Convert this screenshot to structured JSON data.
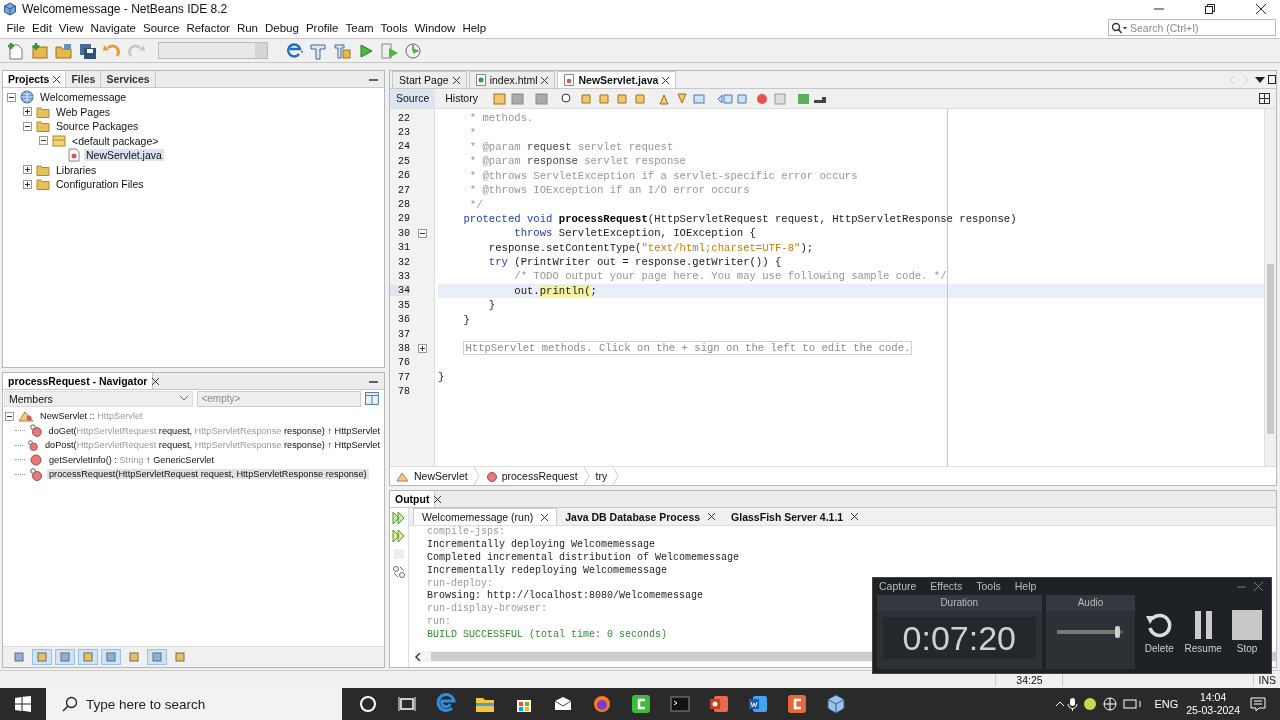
{
  "window": {
    "title": "Welcomemessage - NetBeans IDE 8.2"
  },
  "menu": [
    "File",
    "Edit",
    "View",
    "Navigate",
    "Source",
    "Refactor",
    "Run",
    "Debug",
    "Profile",
    "Team",
    "Tools",
    "Window",
    "Help"
  ],
  "search": {
    "placeholder": "Search (Ctrl+I)"
  },
  "toolbar": [
    {
      "kind": "new-file",
      "disabled": false
    },
    {
      "kind": "new-project",
      "disabled": false
    },
    {
      "kind": "open-project",
      "disabled": false
    },
    {
      "kind": "save-all",
      "disabled": false
    },
    {
      "kind": "undo",
      "disabled": false
    },
    {
      "kind": "redo",
      "disabled": true
    },
    {
      "kind": "config",
      "disabled": false
    },
    {
      "kind": "browser",
      "disabled": false
    },
    {
      "kind": "build",
      "disabled": false
    },
    {
      "kind": "clean-build",
      "disabled": false
    },
    {
      "kind": "run",
      "disabled": false
    },
    {
      "kind": "debug",
      "disabled": false
    },
    {
      "kind": "profile",
      "disabled": false
    }
  ],
  "projects_panel": {
    "tabs": [
      {
        "label": "Projects",
        "selected": true
      },
      {
        "label": "Files",
        "selected": false
      },
      {
        "label": "Services",
        "selected": false
      }
    ],
    "tree": [
      {
        "label": "Welcomemessage",
        "kind": "project",
        "expanded": true,
        "selected": false,
        "children": [
          {
            "label": "Web Pages",
            "kind": "folder",
            "expanded": false,
            "selected": false
          },
          {
            "label": "Source Packages",
            "kind": "folder",
            "expanded": true,
            "selected": false,
            "children": [
              {
                "label": "<default package>",
                "kind": "package",
                "expanded": true,
                "selected": false,
                "children": [
                  {
                    "label": "NewServlet.java",
                    "kind": "file",
                    "selected": true
                  }
                ]
              }
            ]
          },
          {
            "label": "Libraries",
            "kind": "folder",
            "expanded": false,
            "selected": false
          },
          {
            "label": "Configuration Files",
            "kind": "folder",
            "expanded": false,
            "selected": false
          }
        ]
      }
    ]
  },
  "navigator": {
    "title": "processRequest - Navigator",
    "filter": "Members",
    "search_placeholder": "<empty>",
    "tree": [
      {
        "kind": "class",
        "expanded": true,
        "selected": false,
        "parts": [
          {
            "text": "NewServlet :: ",
            "muted": false
          },
          {
            "text": "HttpServlet",
            "muted": true
          }
        ],
        "children": [
          {
            "kind": "method",
            "selected": false,
            "parts": [
              {
                "text": "doGet(",
                "muted": false
              },
              {
                "text": "HttpServletRequest",
                "muted": true
              },
              {
                "text": " request, ",
                "muted": false
              },
              {
                "text": "HttpServletResponse",
                "muted": true
              },
              {
                "text": " response) ↑ HttpServlet",
                "muted": false
              }
            ]
          },
          {
            "kind": "method",
            "selected": false,
            "parts": [
              {
                "text": "doPost(",
                "muted": false
              },
              {
                "text": "HttpServletRequest",
                "muted": true
              },
              {
                "text": " request, ",
                "muted": false
              },
              {
                "text": "HttpServletResponse",
                "muted": true
              },
              {
                "text": " response) ↑ HttpServlet",
                "muted": false
              }
            ]
          },
          {
            "kind": "public-method",
            "selected": false,
            "parts": [
              {
                "text": "getServletInfo() : ",
                "muted": false
              },
              {
                "text": "String",
                "muted": true
              },
              {
                "text": " ↑ GenericServlet",
                "muted": false
              }
            ]
          },
          {
            "kind": "method",
            "selected": true,
            "parts": [
              {
                "text": "processRequest(HttpServletRequest request, HttpServletResponse response)",
                "muted": false
              }
            ]
          }
        ]
      }
    ],
    "tools": [
      {
        "pressed": false
      },
      {
        "pressed": true
      },
      {
        "pressed": true
      },
      {
        "pressed": true
      },
      {
        "pressed": true
      },
      {
        "pressed": false
      },
      {
        "pressed": true
      },
      {
        "pressed": false
      }
    ]
  },
  "editor": {
    "tabs": [
      {
        "label": "Start Page",
        "kind": "page",
        "selected": false
      },
      {
        "label": "index.html",
        "kind": "html",
        "selected": false
      },
      {
        "label": "NewServlet.java",
        "kind": "java",
        "selected": true
      }
    ],
    "views": [
      {
        "label": "Source",
        "selected": true
      },
      {
        "label": "History",
        "selected": false
      }
    ],
    "lines": [
      {
        "number": "22",
        "current": false,
        "segments": [
          {
            "kind": "comment",
            "text": "     * methods."
          }
        ]
      },
      {
        "number": "23",
        "current": false,
        "segments": [
          {
            "kind": "comment",
            "text": "     *"
          }
        ]
      },
      {
        "number": "24",
        "current": false,
        "segments": [
          {
            "kind": "comment",
            "text": "     * "
          },
          {
            "kind": "tag",
            "text": "@param"
          },
          {
            "kind": "name",
            "text": " request"
          },
          {
            "kind": "comment",
            "text": " servlet request"
          }
        ]
      },
      {
        "number": "25",
        "current": false,
        "segments": [
          {
            "kind": "comment",
            "text": "     * "
          },
          {
            "kind": "tag",
            "text": "@param"
          },
          {
            "kind": "name",
            "text": " response"
          },
          {
            "kind": "comment",
            "text": " servlet response"
          }
        ]
      },
      {
        "number": "26",
        "current": false,
        "segments": [
          {
            "kind": "comment",
            "text": "     * @throws ServletException if a servlet-specific error occurs"
          }
        ]
      },
      {
        "number": "27",
        "current": false,
        "segments": [
          {
            "kind": "comment",
            "text": "     * @throws IOException if an I/O error occurs"
          }
        ]
      },
      {
        "number": "28",
        "current": false,
        "segments": [
          {
            "kind": "comment",
            "text": "     */"
          }
        ]
      },
      {
        "number": "29",
        "current": false,
        "segments": [
          {
            "kind": "keyword",
            "text": "    protected void "
          },
          {
            "kind": "method",
            "text": "processRequest"
          },
          {
            "kind": "plain",
            "text": "(HttpServletRequest request, HttpServletResponse response)"
          }
        ]
      },
      {
        "number": "30",
        "expanded": true,
        "current": false,
        "segments": [
          {
            "kind": "keyword",
            "text": "            throws "
          },
          {
            "kind": "plain",
            "text": "ServletException, IOException {"
          }
        ]
      },
      {
        "number": "31",
        "current": false,
        "segments": [
          {
            "kind": "plain",
            "text": "        response.setContentType("
          },
          {
            "kind": "string",
            "text": "\"text/html;charset=UTF-8\""
          },
          {
            "kind": "plain",
            "text": ");"
          }
        ]
      },
      {
        "number": "32",
        "current": false,
        "segments": [
          {
            "kind": "keyword",
            "text": "        try "
          },
          {
            "kind": "plain",
            "text": "(PrintWriter out = response.getWriter()) {"
          }
        ]
      },
      {
        "number": "33",
        "current": false,
        "segments": [
          {
            "kind": "comment",
            "text": "            /* TODO output your page here. You may use following sample code. */"
          }
        ]
      },
      {
        "number": "34",
        "current": true,
        "segments": [
          {
            "kind": "plain",
            "text": "            out."
          },
          {
            "kind": "highlight",
            "text": "println("
          },
          {
            "kind": "plain",
            "text": ";"
          }
        ]
      },
      {
        "number": "35",
        "current": false,
        "segments": [
          {
            "kind": "plain",
            "text": "        }"
          }
        ]
      },
      {
        "number": "36",
        "current": false,
        "segments": [
          {
            "kind": "plain",
            "text": "    }"
          }
        ]
      },
      {
        "number": "37",
        "current": false
      },
      {
        "number": "38",
        "expanded": false,
        "current": false,
        "segments": [
          {
            "kind": "folded",
            "text": "HttpServlet methods. Click on the + sign on the left to edit the code."
          }
        ]
      },
      {
        "number": "76",
        "current": false
      },
      {
        "number": "77",
        "current": false,
        "segments": [
          {
            "kind": "plain",
            "text": "}"
          }
        ]
      },
      {
        "number": "78",
        "current": false
      }
    ],
    "breadcrumbs": [
      {
        "label": "NewServlet",
        "kind": "class"
      },
      {
        "label": "processRequest",
        "kind": "method"
      },
      {
        "label": "try",
        "kind": "block"
      }
    ]
  },
  "output": {
    "title": "Output",
    "tabs": [
      {
        "label": "Welcomemessage (run)",
        "selected": true
      },
      {
        "label": "Java DB Database Process",
        "selected": false
      },
      {
        "label": "GlassFish Server 4.1.1",
        "selected": false
      }
    ],
    "actions": [
      {
        "kind": "rerun",
        "disabled": false
      },
      {
        "kind": "rerun-params",
        "disabled": false
      },
      {
        "kind": "stop",
        "disabled": true
      },
      {
        "kind": "settings",
        "disabled": false
      }
    ],
    "lines": [
      {
        "kind": "target",
        "text": "compile-jsps:"
      },
      {
        "kind": "info",
        "text": "Incrementally deploying Welcomemessage"
      },
      {
        "kind": "info",
        "text": "Completed incremental distribution of Welcomemessage"
      },
      {
        "kind": "info",
        "text": "Incrementally redeploying Welcomemessage"
      },
      {
        "kind": "target",
        "text": "run-deploy:"
      },
      {
        "kind": "info",
        "text": "Browsing: http://localhost:8080/Welcomemessage"
      },
      {
        "kind": "target",
        "text": "run-display-browser:"
      },
      {
        "kind": "target",
        "text": "run:"
      },
      {
        "kind": "success",
        "text": "BUILD SUCCESSFUL (total time: 0 seconds)"
      }
    ]
  },
  "status_bar": {
    "position": "34:25",
    "mode": "INS"
  },
  "recorder": {
    "menu": [
      "Capture",
      "Effects",
      "Tools",
      "Help"
    ],
    "duration_label": "Duration",
    "duration": "0:07:20",
    "audio_label": "Audio",
    "audio": {
      "level": 0.92
    },
    "buttons": [
      {
        "kind": "delete",
        "label": "Delete"
      },
      {
        "kind": "resume",
        "label": "Resume"
      },
      {
        "kind": "stop",
        "label": "Stop"
      }
    ]
  },
  "taskbar": {
    "search_placeholder": "Type here to search",
    "apps": [
      {
        "kind": "cortana"
      },
      {
        "kind": "task-view"
      },
      {
        "kind": "edge"
      },
      {
        "kind": "explorer"
      },
      {
        "kind": "store"
      },
      {
        "kind": "mail"
      },
      {
        "kind": "firefox"
      },
      {
        "kind": "camtasia"
      },
      {
        "kind": "terminal"
      },
      {
        "kind": "powerpoint"
      },
      {
        "kind": "word"
      },
      {
        "kind": "recorder"
      },
      {
        "kind": "netbeans"
      }
    ],
    "language": "ENG",
    "time": "14:04",
    "date": "25-03-2024"
  }
}
